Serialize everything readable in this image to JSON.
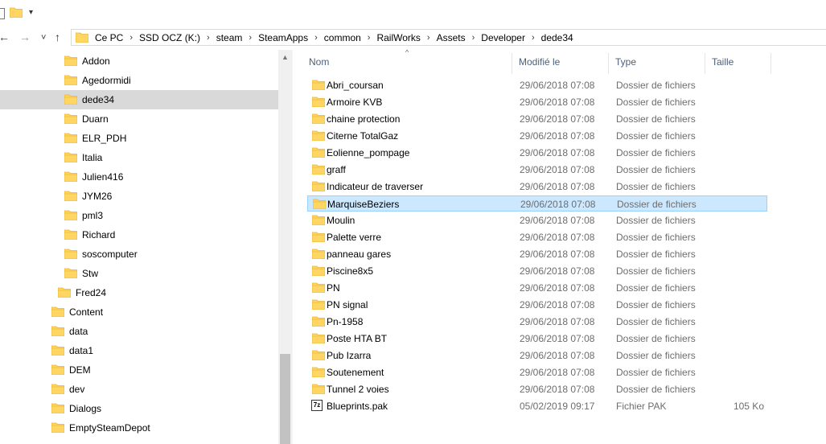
{
  "quick_access": {
    "dropdown_glyph": "▾"
  },
  "nav": {
    "back": "←",
    "forward": "→",
    "recent": "˅",
    "up": "↑"
  },
  "breadcrumbs": [
    "Ce PC",
    "SSD OCZ (K:)",
    "steam",
    "SteamApps",
    "common",
    "RailWorks",
    "Assets",
    "Developer",
    "dede34"
  ],
  "breadcrumb_separator": "›",
  "tree": [
    {
      "label": "Addon"
    },
    {
      "label": "Agedormidi"
    },
    {
      "label": "dede34",
      "selected": true
    },
    {
      "label": "Duarn"
    },
    {
      "label": "ELR_PDH"
    },
    {
      "label": "Italia"
    },
    {
      "label": "Julien416"
    },
    {
      "label": "JYM26"
    },
    {
      "label": "pml3"
    },
    {
      "label": "Richard"
    },
    {
      "label": "soscomputer"
    },
    {
      "label": "Stw"
    },
    {
      "label": "Fred24"
    },
    {
      "label": "Content"
    },
    {
      "label": "data"
    },
    {
      "label": "data1"
    },
    {
      "label": "DEM"
    },
    {
      "label": "dev"
    },
    {
      "label": "Dialogs"
    },
    {
      "label": "EmptySteamDepot"
    }
  ],
  "columns": {
    "name": "Nom",
    "modified": "Modifié le",
    "type": "Type",
    "size": "Taille",
    "sort_glyph": "^"
  },
  "files": [
    {
      "name": "Abri_coursan",
      "modified": "29/06/2018 07:08",
      "type": "Dossier de fichiers",
      "size": "",
      "kind": "folder"
    },
    {
      "name": "Armoire KVB",
      "modified": "29/06/2018 07:08",
      "type": "Dossier de fichiers",
      "size": "",
      "kind": "folder"
    },
    {
      "name": "chaine protection",
      "modified": "29/06/2018 07:08",
      "type": "Dossier de fichiers",
      "size": "",
      "kind": "folder"
    },
    {
      "name": "Citerne TotalGaz",
      "modified": "29/06/2018 07:08",
      "type": "Dossier de fichiers",
      "size": "",
      "kind": "folder"
    },
    {
      "name": "Eolienne_pompage",
      "modified": "29/06/2018 07:08",
      "type": "Dossier de fichiers",
      "size": "",
      "kind": "folder"
    },
    {
      "name": "graff",
      "modified": "29/06/2018 07:08",
      "type": "Dossier de fichiers",
      "size": "",
      "kind": "folder"
    },
    {
      "name": "Indicateur de traverser",
      "modified": "29/06/2018 07:08",
      "type": "Dossier de fichiers",
      "size": "",
      "kind": "folder"
    },
    {
      "name": "MarquiseBeziers",
      "modified": "29/06/2018 07:08",
      "type": "Dossier de fichiers",
      "size": "",
      "kind": "folder",
      "selected": true
    },
    {
      "name": "Moulin",
      "modified": "29/06/2018 07:08",
      "type": "Dossier de fichiers",
      "size": "",
      "kind": "folder"
    },
    {
      "name": "Palette verre",
      "modified": "29/06/2018 07:08",
      "type": "Dossier de fichiers",
      "size": "",
      "kind": "folder"
    },
    {
      "name": "panneau gares",
      "modified": "29/06/2018 07:08",
      "type": "Dossier de fichiers",
      "size": "",
      "kind": "folder"
    },
    {
      "name": "Piscine8x5",
      "modified": "29/06/2018 07:08",
      "type": "Dossier de fichiers",
      "size": "",
      "kind": "folder"
    },
    {
      "name": "PN",
      "modified": "29/06/2018 07:08",
      "type": "Dossier de fichiers",
      "size": "",
      "kind": "folder"
    },
    {
      "name": "PN signal",
      "modified": "29/06/2018 07:08",
      "type": "Dossier de fichiers",
      "size": "",
      "kind": "folder"
    },
    {
      "name": "Pn-1958",
      "modified": "29/06/2018 07:08",
      "type": "Dossier de fichiers",
      "size": "",
      "kind": "folder"
    },
    {
      "name": "Poste HTA BT",
      "modified": "29/06/2018 07:08",
      "type": "Dossier de fichiers",
      "size": "",
      "kind": "folder"
    },
    {
      "name": "Pub Izarra",
      "modified": "29/06/2018 07:08",
      "type": "Dossier de fichiers",
      "size": "",
      "kind": "folder"
    },
    {
      "name": "Soutenement",
      "modified": "29/06/2018 07:08",
      "type": "Dossier de fichiers",
      "size": "",
      "kind": "folder"
    },
    {
      "name": "Tunnel 2 voies",
      "modified": "29/06/2018 07:08",
      "type": "Dossier de fichiers",
      "size": "",
      "kind": "folder"
    },
    {
      "name": "Blueprints.pak",
      "modified": "05/02/2019 09:17",
      "type": "Fichier PAK",
      "size": "105 Ko",
      "kind": "file",
      "icon_text": "7z"
    }
  ],
  "colors": {
    "folder": "#ffd664",
    "folder_dark": "#e8b530",
    "selection": "#cce8ff",
    "selection_border": "#99d1ff",
    "tree_selection": "#d9d9d9",
    "header_text": "#4c607a"
  }
}
